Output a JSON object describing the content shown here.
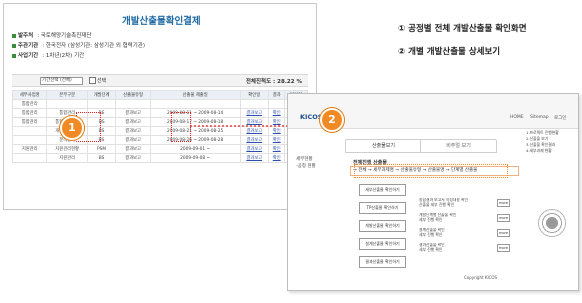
{
  "notes": [
    "① 공정별 전체 개발산출물 확인화면",
    "② 개별 개발산출물 상세보기"
  ],
  "screen1": {
    "title": "개발산출물확인결제",
    "meta": [
      {
        "key": "발주처",
        "value": ": 국토해양기술촉진재단"
      },
      {
        "key": "주관기관",
        "value": ": 한국전자 (삼성기관: 삼성기관 외 협력기관)"
      },
      {
        "key": "사업기간",
        "value": ": 1차년(2차) 기간"
      }
    ],
    "filter": {
      "select": "기간선택 (전체)",
      "checkbox_label": "선택"
    },
    "rate": "전체진척도 : 28.22 %",
    "headers": [
      "세부사업명",
      "본부구분",
      "개발단계",
      "산출물유형",
      "산출물 제출일",
      "확인일",
      "결과",
      "담당자"
    ],
    "rows": [
      {
        "name": "통합관리",
        "org": "",
        "stage": "",
        "type": "",
        "date": "",
        "check": "",
        "result": "",
        "person": ""
      },
      {
        "name": "통합관리",
        "org": "통합관리",
        "stage": "RE",
        "type": "결과보고",
        "date": "2009-08-11 ~ 2009-08-14",
        "check": "결과보고",
        "result": "확인",
        "person": "보통"
      },
      {
        "name": "통합관리",
        "org": "통합관리계획",
        "stage": "DS",
        "type": "결과보고",
        "date": "2009-08-17 ~ 2009-08-18",
        "check": "결과보고",
        "result": "확인",
        "person": "보통"
      },
      {
        "name": "",
        "org": "개발준비문서",
        "stage": "BS",
        "type": "결과보고",
        "date": "2009-08-21 ~ 2009-08-25",
        "check": "결과보고",
        "result": "확인",
        "person": "보통"
      },
      {
        "name": "",
        "org": "분석단계",
        "stage": "BS",
        "type": "결과보고",
        "date": "2009-08-26 ~ 2009-08-28",
        "check": "결과보고",
        "result": "확인",
        "person": "보통"
      },
      {
        "name": "지원관리",
        "org": "지원관리현황",
        "stage": "PSM",
        "type": "결과보고",
        "date": "2009-09-01 ~",
        "check": "결과보고",
        "result": "확인",
        "person": "보통"
      },
      {
        "name": "",
        "org": "지원관리",
        "stage": "BS",
        "type": "결과보고",
        "date": "2009-09-08 ~",
        "check": "결과보고",
        "result": "확인",
        "person": "보통"
      }
    ]
  },
  "screen2": {
    "logo": "KICOS",
    "nav": [
      "HOME",
      "Sitemap",
      "로그인"
    ],
    "tabs": [
      "산출물보기",
      "비주얼 보기"
    ],
    "section": "전체진행 산출물",
    "crumb": "→ 전체 → 세부과제명 → 산출물유형 → 산출물명 → 단계별 산출물",
    "side": [
      "세부현황",
      "-공정 현황"
    ],
    "buttons": [
      "세부산출물 확인하기",
      "TP산출물 확인하기",
      "개발산출물 확인하기",
      "설계산출물 확인하기",
      "결과산출물 확인하기"
    ],
    "items": [
      [
        "종합결과 보고서 작성내용 확인",
        "산출물 세부 진행 확인"
      ],
      [
        "개발단계별 산출물 확인",
        "세부 진행 확인"
      ],
      [
        "설계산출물 확인",
        "세부 진행 확인"
      ],
      [
        "결과산출물 확인",
        "세부 진행 확인"
      ]
    ],
    "more_label": "more",
    "rpanel": [
      "1.프로젝트 진행현황",
      "2.산출물 보기",
      "3.산출물 확인결과",
      "4.세부과제 현황"
    ],
    "footer": "Copyright KICOS"
  },
  "markers": [
    "1",
    "2"
  ],
  "colors": {
    "accent": "#f08a24",
    "title": "#1f6aa5",
    "highlight": "#e02020"
  }
}
